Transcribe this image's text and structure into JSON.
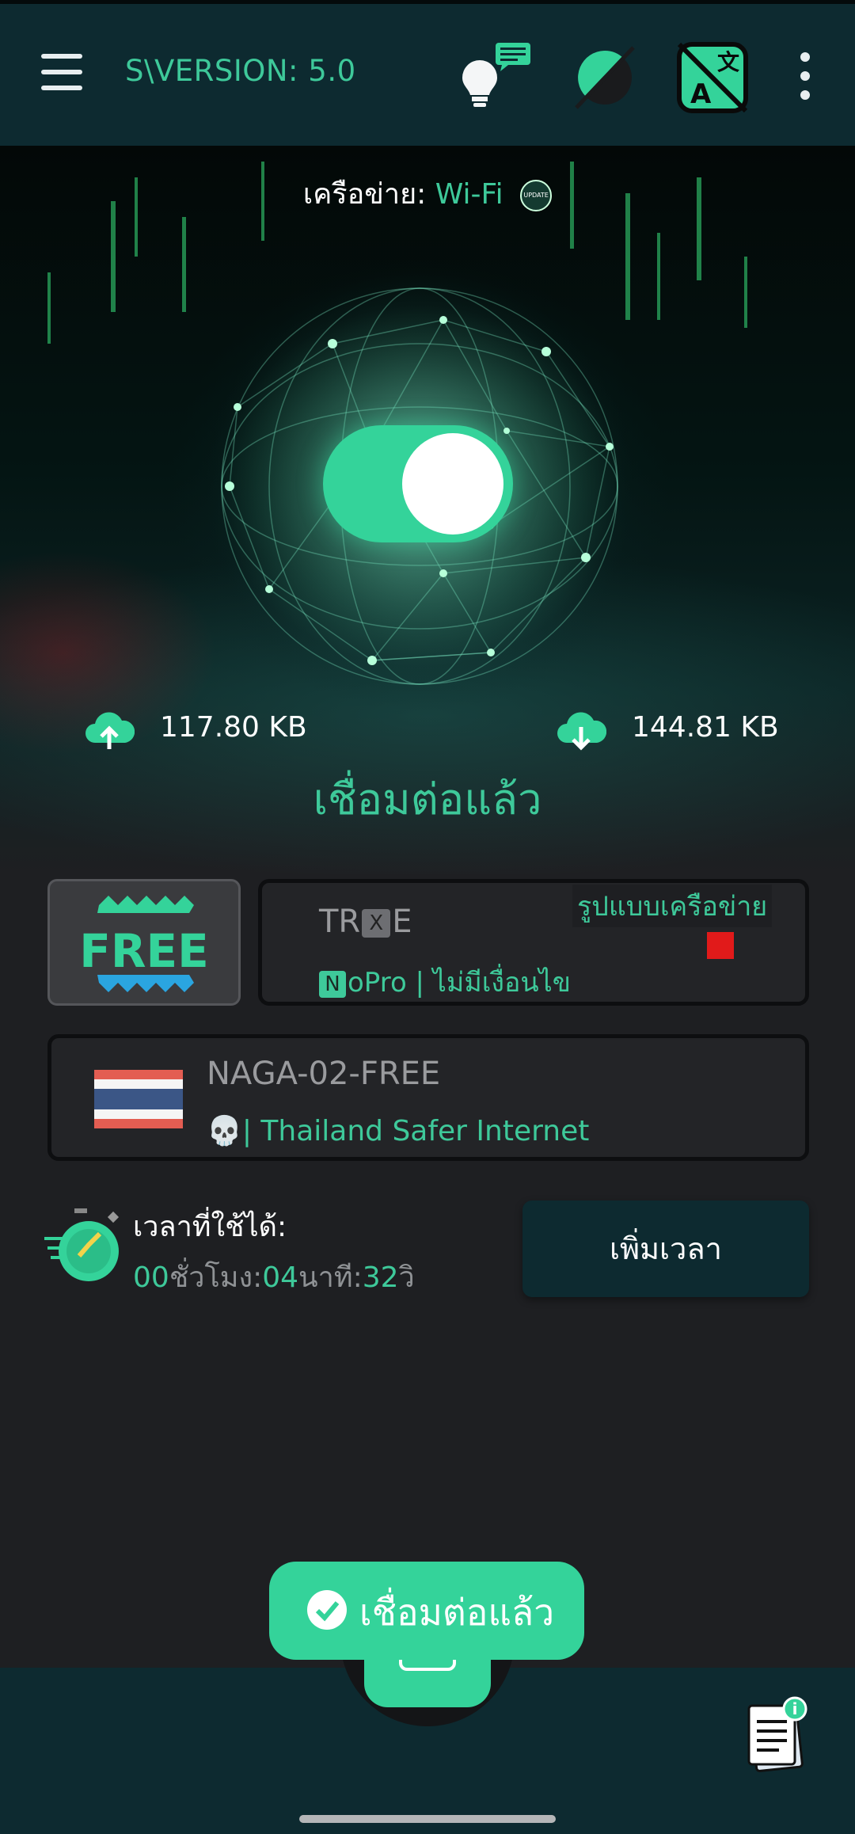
{
  "appbar": {
    "version_label": "S\\VERSION: 5.0",
    "icons": [
      "menu-icon",
      "lightbulb-chat-icon",
      "dark-mode-icon",
      "translate-icon",
      "more-vert-icon"
    ]
  },
  "hero": {
    "network_prefix": "เครือข่าย:",
    "network_value": "Wi-Fi",
    "update_badge": "UPDATE",
    "toggle_on": true,
    "upload": "117.80 KB",
    "download": "144.81 KB",
    "status": "เชื่อมต่อแล้ว"
  },
  "config": {
    "free_badge": "FREE",
    "title_pre": "TR",
    "title_box": "X",
    "title_post": "E",
    "sub_box": "N",
    "sub_text": "oPro | ไม่มีเงื่อนไข",
    "network_mode_label": "รูปแบบเครือข่าย"
  },
  "server": {
    "name": "NAGA-02-FREE",
    "desc": "| Thailand Safer Internet",
    "skull": "💀"
  },
  "timer": {
    "label": "เวลาที่ใช้ได้:",
    "h": "00",
    "h_unit": "ชั่วโมง:",
    "m": "04",
    "m_unit": "นาที:",
    "s": "32",
    "s_unit": "วิ",
    "add_button": "เพิ่มเวลา"
  },
  "toast": {
    "text": "เชื่อมต่อแล้ว"
  },
  "colors": {
    "accent": "#34d39a",
    "bar": "#0d2a30",
    "bg": "#1e1f22"
  }
}
